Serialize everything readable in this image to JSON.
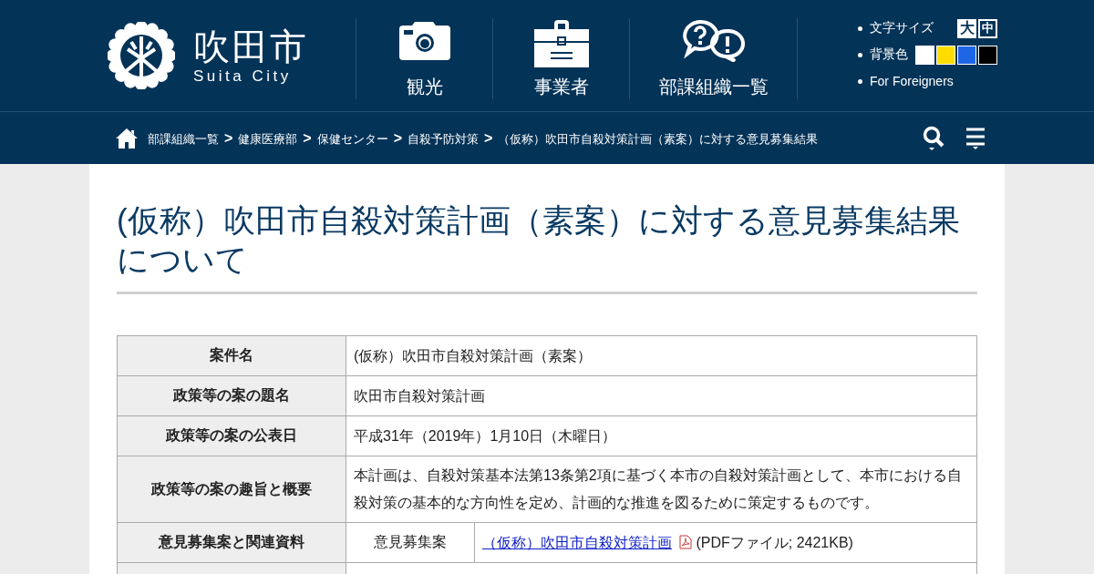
{
  "header": {
    "logo_title": "吹田市",
    "logo_subtitle": "Suita City",
    "nav": [
      {
        "kind": "camera",
        "label": "観光"
      },
      {
        "kind": "briefcase",
        "label": "事業者"
      },
      {
        "kind": "speech",
        "label": "部課組織一覧"
      }
    ],
    "font_size": {
      "label": "文字サイズ",
      "options": [
        {
          "label": "大",
          "selected": false
        },
        {
          "label": "中",
          "selected": true
        }
      ]
    },
    "background": {
      "label": "背景色",
      "swatches": [
        {
          "color": "#ffffff"
        },
        {
          "color": "#ffdd00"
        },
        {
          "color": "#1e66e6"
        },
        {
          "color": "#000000"
        }
      ]
    },
    "foreign_link": "For Foreigners"
  },
  "breadcrumb": [
    {
      "label": "部課組織一覧",
      "separator": ">"
    },
    {
      "label": "健康医療部",
      "separator": ">"
    },
    {
      "label": "保健センター",
      "separator": ">"
    },
    {
      "label": "自殺予防対策",
      "separator": ">"
    }
  ],
  "breadcrumb_current": "（仮称）吹田市自殺対策計画（素案）に対する意見募集結果",
  "title": "(仮称）吹田市自殺対策計画（素案）に対する意見募集結果について",
  "table": {
    "rows": [
      {
        "kind": "text",
        "header": "案件名",
        "value": "(仮称）吹田市自殺対策計画（素案）"
      },
      {
        "kind": "text",
        "header": "政策等の案の題名",
        "value": "吹田市自殺対策計画"
      },
      {
        "kind": "text",
        "header": "政策等の案の公表日",
        "value": "平成31年（2019年）1月10日（木曜日）"
      },
      {
        "kind": "text",
        "header": "政策等の案の趣旨と概要",
        "value": "本計画は、自殺対策基本法第13条第2項に基づく本市の自殺対策計画として、本市における自殺対策の基本的な方向性を定め、計画的な推進を図るために策定するものです。"
      },
      {
        "kind": "document",
        "header": "意見募集案と関連資料",
        "sublabel": "意見募集案",
        "link": "（仮称）吹田市自殺対策計画",
        "info": "(PDFファイル; 2421KB)"
      },
      {
        "kind": "blank"
      }
    ]
  }
}
